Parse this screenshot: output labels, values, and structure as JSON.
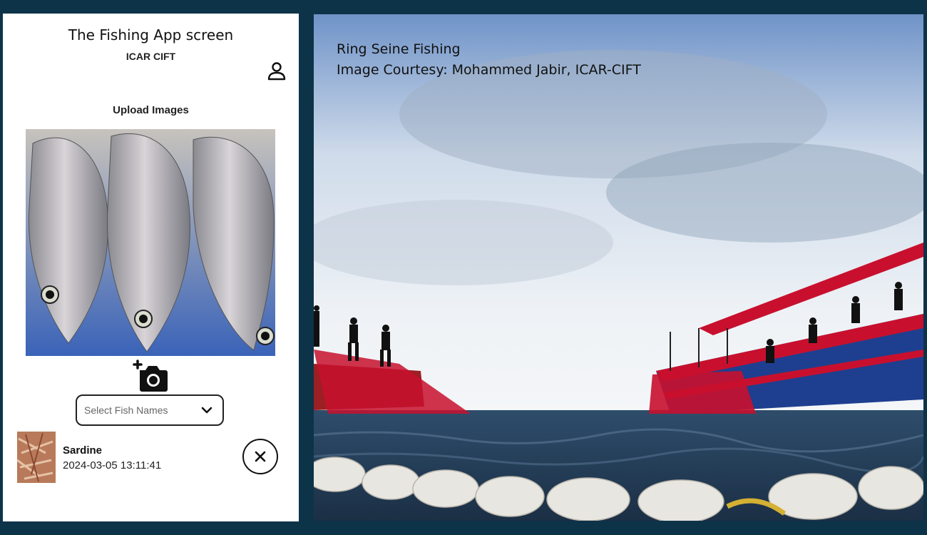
{
  "app": {
    "title": "The Fishing App screen",
    "org": "ICAR CIFT",
    "upload_label": "Upload Images"
  },
  "select": {
    "placeholder": "Select Fish Names"
  },
  "entry": {
    "name": "Sardine",
    "timestamp": "2024-03-05 13:11:41"
  },
  "photo": {
    "caption_line1": "Ring Seine Fishing",
    "caption_line2": "Image Courtesy: Mohammed Jabir, ICAR-CIFT"
  },
  "icons": [
    "person-icon",
    "add-camera-icon",
    "chevron-down-icon",
    "close-icon"
  ],
  "colors": {
    "background": "#0d3349",
    "net_red": "#c8102e",
    "hull_blue": "#1e3f8f"
  }
}
